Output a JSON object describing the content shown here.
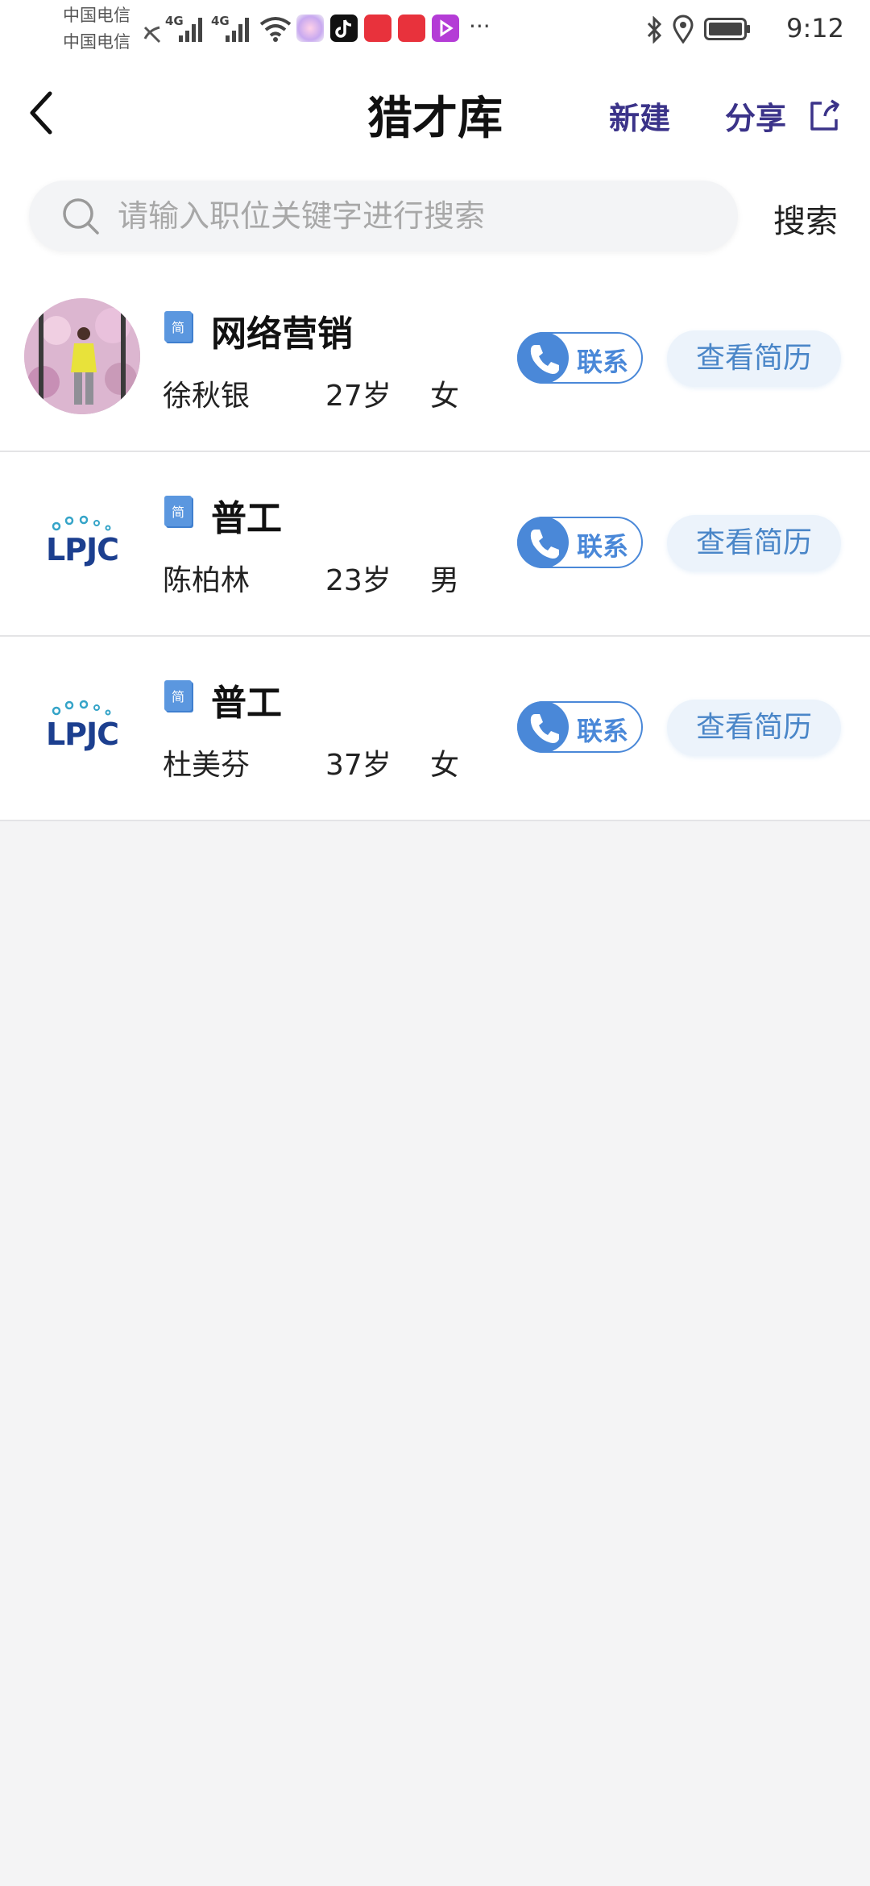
{
  "status_bar": {
    "carrier_1": "中国电信",
    "carrier_2": "中国电信",
    "network_1": "4G",
    "network_2": "4G",
    "time": "9:12",
    "app_icons": [
      "photos-app-icon",
      "tiktok-app-icon",
      "toutiao-app-icon",
      "app-icon-red",
      "video-app-icon"
    ],
    "more_indicator": "···"
  },
  "header": {
    "title": "猎才库",
    "new_label": "新建",
    "share_label": "分享"
  },
  "search": {
    "placeholder": "请输入职位关键字进行搜索",
    "value": "",
    "button_label": "搜索"
  },
  "tag_glyph": "简",
  "logo_text": "LPJC",
  "candidates": [
    {
      "job": "网络营销",
      "name": "徐秋银",
      "age": "27岁",
      "gender": "女",
      "avatar": "photo",
      "contact_label": "联系",
      "resume_label": "查看简历"
    },
    {
      "job": "普工",
      "name": "陈柏林",
      "age": "23岁",
      "gender": "男",
      "avatar": "company-logo",
      "contact_label": "联系",
      "resume_label": "查看简历"
    },
    {
      "job": "普工",
      "name": "杜美芬",
      "age": "37岁",
      "gender": "女",
      "avatar": "company-logo",
      "contact_label": "联系",
      "resume_label": "查看简历"
    }
  ],
  "colors": {
    "accent_blue": "#4a88d8",
    "header_action": "#3b3389",
    "page_bg": "#f4f4f5"
  }
}
